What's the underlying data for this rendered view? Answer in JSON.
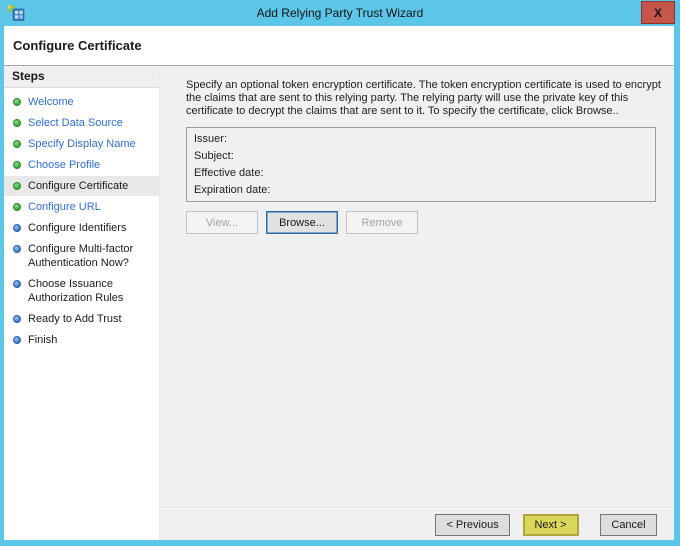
{
  "window": {
    "title": "Add Relying Party Trust Wizard",
    "close_glyph": "X"
  },
  "header": {
    "title": "Configure Certificate"
  },
  "steps": {
    "header": "Steps",
    "items": [
      {
        "label": "Welcome",
        "bullet": "green",
        "state": "link"
      },
      {
        "label": "Select Data Source",
        "bullet": "green",
        "state": "link"
      },
      {
        "label": "Specify Display Name",
        "bullet": "green",
        "state": "link"
      },
      {
        "label": "Choose Profile",
        "bullet": "green",
        "state": "link"
      },
      {
        "label": "Configure Certificate",
        "bullet": "green",
        "state": "current"
      },
      {
        "label": "Configure URL",
        "bullet": "green",
        "state": "link"
      },
      {
        "label": "Configure Identifiers",
        "bullet": "blue",
        "state": "normal"
      },
      {
        "label": "Configure Multi-factor Authentication Now?",
        "bullet": "blue",
        "state": "normal"
      },
      {
        "label": "Choose Issuance Authorization Rules",
        "bullet": "blue",
        "state": "normal"
      },
      {
        "label": "Ready to Add Trust",
        "bullet": "blue",
        "state": "normal"
      },
      {
        "label": "Finish",
        "bullet": "blue",
        "state": "normal"
      }
    ]
  },
  "content": {
    "description": "Specify an optional token encryption certificate.  The token encryption certificate is used to encrypt the claims that are sent to this relying party.  The relying party will use the private key of this certificate to decrypt the claims that are sent to it.  To specify the certificate, click Browse..",
    "certificate": {
      "fields": [
        {
          "label": "Issuer:",
          "value": ""
        },
        {
          "label": "Subject:",
          "value": ""
        },
        {
          "label": "Effective date:",
          "value": ""
        },
        {
          "label": "Expiration date:",
          "value": ""
        }
      ]
    },
    "buttons": {
      "view": "View...",
      "browse": "Browse...",
      "remove": "Remove"
    }
  },
  "footer": {
    "previous": "< Previous",
    "next": "Next >",
    "cancel": "Cancel"
  },
  "colors": {
    "titlebar_blue": "#5CC6E8",
    "close_red": "#C4564B",
    "close_red_border": "#8F3125",
    "link_blue": "#2E6FD8",
    "bullet_green": "#3AA93A",
    "bullet_blue": "#3C78CF",
    "next_yellow": "#D9D75A",
    "next_yellow_border": "#AFA63E",
    "focus_blue": "#2D69A0"
  }
}
